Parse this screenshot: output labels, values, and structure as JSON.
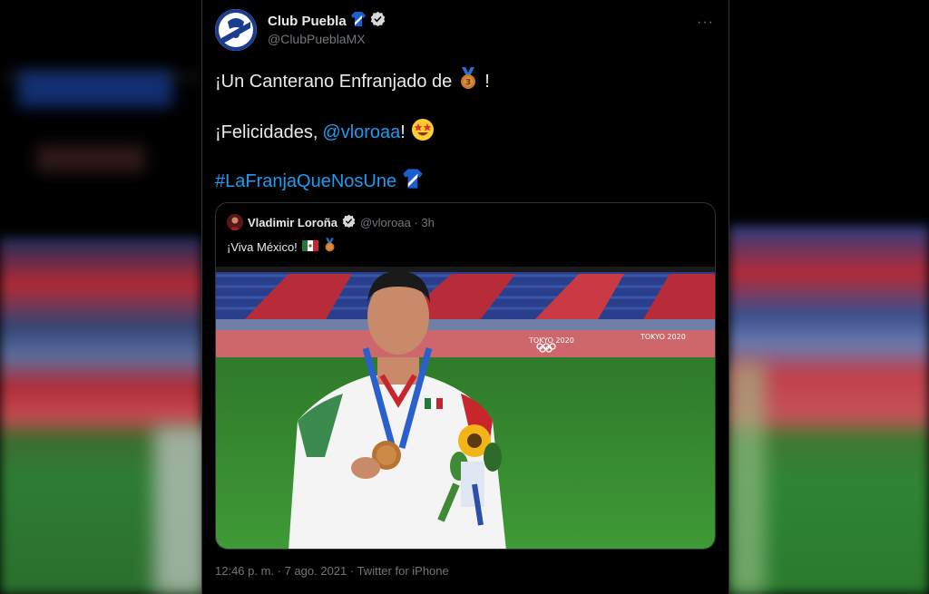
{
  "tweet": {
    "display_name": "Club Puebla",
    "handle": "@ClubPueblaMX",
    "line1": "¡Un Canterano Enfranjado de",
    "line1_end": "!",
    "line2_start": "¡Felicidades,",
    "line2_mention": "@vloroaa",
    "line2_end": "!",
    "hashtag": "#LaFranjaQueNosUne",
    "timestamp": "12:46 p. m. · 7 ago. 2021 · Twitter for iPhone"
  },
  "quote": {
    "display_name": "Vladimir Loroña",
    "meta": "@vloroaa · 3h",
    "text": "¡Viva México!"
  },
  "photo": {
    "banner_text_1": "TOKYO 2020",
    "banner_text_2": "TOKYO 2020"
  },
  "colors": {
    "background": "#000000",
    "text": "#e7e9ea",
    "muted": "#71767b",
    "link": "#1d9bf0",
    "verified": "#d9d9d9"
  }
}
